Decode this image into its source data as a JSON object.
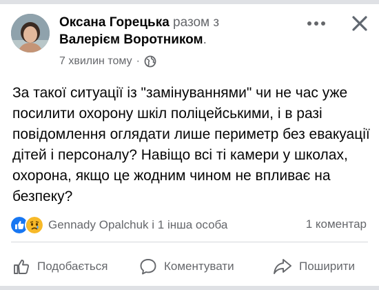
{
  "post": {
    "author": "Оксана Горецька",
    "with_label": "разом з",
    "tagged": "Валерієм Воротником",
    "tagged_suffix": ".",
    "time": "7 хвилин тому",
    "time_sep": "·",
    "privacy_icon": "globe-icon",
    "text": "За такої ситуації із \"замінуваннями\" чи не час уже посилити охорону шкіл поліцейськими, і в разі повідомлення оглядати лише периметр без евакуації дітей і персоналу? Навіщо всі ті камери у школах, охорона, якщо це жодним чином не впливає на безпеку?"
  },
  "reactions": {
    "icons": [
      "like-icon",
      "sad-icon"
    ],
    "names": "Gennady  Opalchuk і 1 інша особа",
    "comments": "1 коментар"
  },
  "actions": {
    "like": "Подобається",
    "comment": "Коментувати",
    "share": "Поширити"
  },
  "colors": {
    "text": "#050505",
    "secondary": "#65676b",
    "like_blue": "#1877f2",
    "sad_yellow": "#f7b928"
  }
}
